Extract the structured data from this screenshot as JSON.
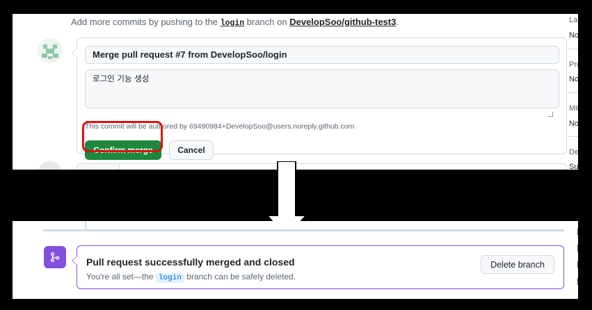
{
  "top": {
    "hint_prefix": "Add more commits by pushing to the",
    "hint_branch": "login",
    "hint_middle": "branch on",
    "hint_repo": "DevelopSoo/github-test3",
    "hint_suffix": ".",
    "merge_form": {
      "commit_title": "Merge pull request #7 from DevelopSoo/login",
      "commit_body": "로그인 기능 생성",
      "author_note": "This commit will be authored by 69490984+DevelopSoo@users.noreply.github.com",
      "confirm_label": "Confirm merge",
      "cancel_label": "Cancel"
    },
    "sidebar": {
      "labels_heading": "La",
      "labels_value": "No",
      "projects_heading": "Pro",
      "projects_value": "No",
      "milestone_heading": "Mil",
      "milestone_value": "No",
      "development_heading": "Dev",
      "development_value": "Su"
    }
  },
  "bottom": {
    "merged_title": "Pull request successfully merged and closed",
    "merged_sub_prefix": "You're all set—the",
    "merged_branch": "login",
    "merged_sub_suffix": "branch can be safely deleted.",
    "delete_branch_label": "Delete branch"
  },
  "colors": {
    "confirm_green": "#1f883d",
    "merged_purple": "#8250df",
    "highlight_red": "#e01010"
  },
  "icons": {
    "merged_icon": "git-merge-icon",
    "avatar": "identicon"
  }
}
